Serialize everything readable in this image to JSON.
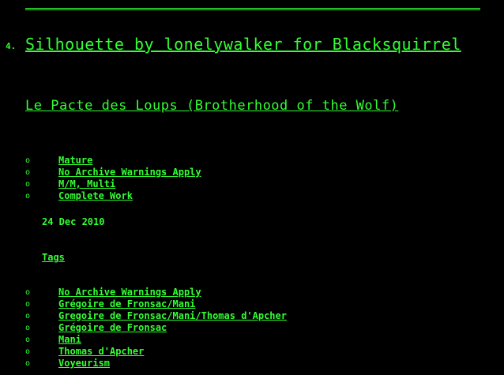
{
  "header": {
    "work_number": "4.",
    "title": "Silhouette by lonelywalker for Blacksquirrel",
    "fandom": "Le Pacte des Loups (Brotherhood of the Wolf)"
  },
  "required_tags": [
    "Mature",
    "No Archive Warnings Apply",
    "M/M, Multi",
    "Complete Work"
  ],
  "date": "24 Dec 2010",
  "tags_heading": "Tags",
  "tags": [
    "No Archive Warnings Apply",
    "Grégoire de Fronsac/Mani",
    "Gregoire de Fronsac/Mani/Thomas d'Apcher",
    "Grégoire de Fronsac",
    "Mani",
    "Thomas d'Apcher",
    "Voyeurism"
  ],
  "bullet_glyph": "o",
  "colors": {
    "background": "#000000",
    "text": "#33ff33"
  }
}
